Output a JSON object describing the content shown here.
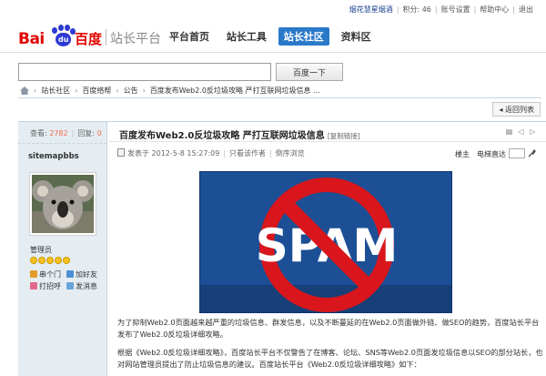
{
  "topbar": {
    "user": "烟花慧星烟酒",
    "credits": "积分: 46",
    "account": "账号设置",
    "help": "帮助中心",
    "logout": "退出"
  },
  "brand": {
    "logo_text": "Bai",
    "logo_paw": "du",
    "logo_cn": "百度",
    "platform": "站长平台"
  },
  "nav": {
    "items": [
      "平台首页",
      "站长工具",
      "站长社区",
      "资料区"
    ],
    "active_index": 2,
    "active_color": "#2a79c9"
  },
  "search": {
    "value": "",
    "button": "百度一下"
  },
  "breadcrumb": {
    "items": [
      "站长社区",
      "百度络帮",
      "公告",
      "百度发布Web2.0反垃圾攻略 严打互联网垃圾信息 ..."
    ]
  },
  "back_button": "返回列表",
  "post": {
    "views_label": "查看:",
    "views": "2782",
    "replies_label": "回复:",
    "replies": "0",
    "author": "sitemapbbs",
    "role": "管理员",
    "actions": [
      "串个门",
      "加好友",
      "打招呼",
      "发消息"
    ],
    "title": "百度发布Web2.0反垃圾攻略 严打互联网垃圾信息",
    "copy_link": "[复制链接]",
    "posted": "发表于 2012-5-8 15:27:09",
    "only_author": "只看该作者",
    "reverse": "倒序浏览",
    "floor": "楼主",
    "direct_floor": "电梯直达",
    "image_text": "SPAM",
    "paragraph1": "为了抑制Web2.0页面越来越严重的垃圾信息、群发信息，以及不断蔓延的在Web2.0页面做外链、做SEO的趋势，百度站长平台发布了Web2.0反垃圾详细攻略。",
    "paragraph2": "根据《Web2.0反垃圾详细攻略》，百度站长平台不仅警告了在博客、论坛、SNS等Web2.0页面发垃圾信息以SEO的部分站长，也对网站管理员提出了防止垃圾信息的建议。百度站长平台《Web2.0反垃圾详细攻略》如下："
  },
  "colors": {
    "sidebar_bg": "#e5edf2",
    "link_blue": "#1a3e8c",
    "stat_orange": "#f26c4f",
    "spam_bg": "#1c4f95",
    "spam_red": "#d8161c"
  }
}
